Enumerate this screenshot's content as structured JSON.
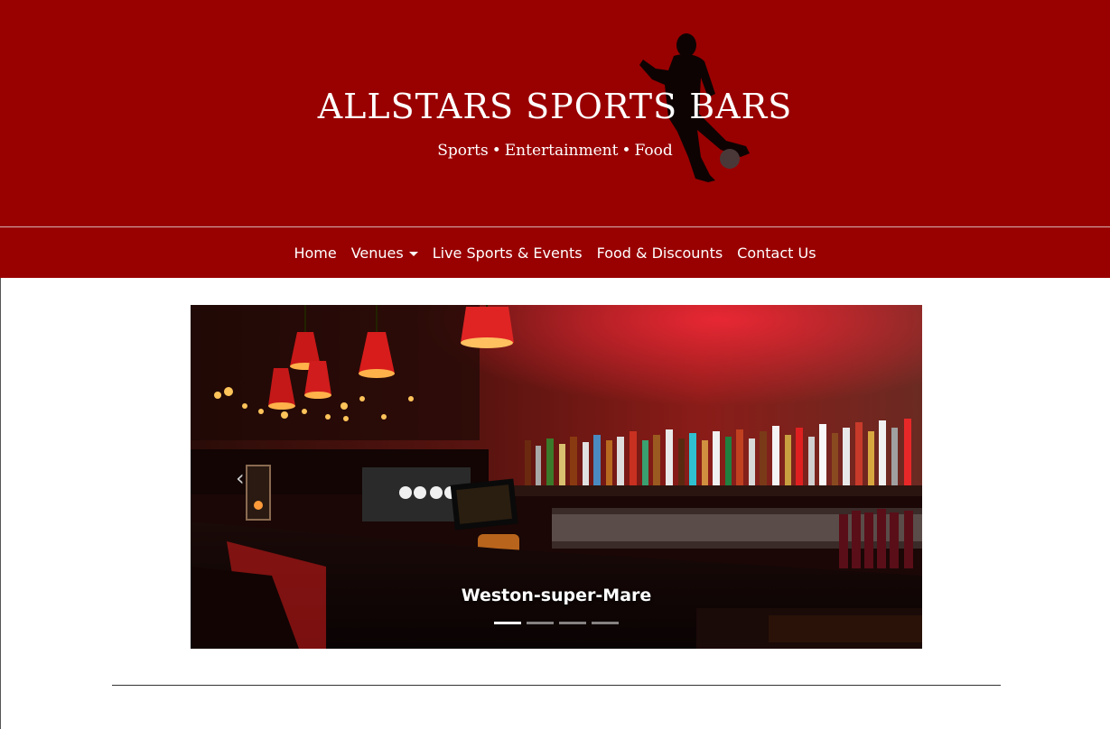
{
  "header": {
    "title": "ALLSTARS SPORTS BARS",
    "tagline_parts": [
      "Sports",
      "Entertainment",
      "Food"
    ],
    "tagline_separator": "•",
    "background_color": "#990000",
    "logo_icon": "footballer-silhouette-icon"
  },
  "nav": {
    "items": [
      {
        "label": "Home"
      },
      {
        "label": "Venues",
        "has_dropdown": true
      },
      {
        "label": "Live Sports & Events"
      },
      {
        "label": "Food & Discounts"
      },
      {
        "label": "Contact Us"
      }
    ]
  },
  "carousel": {
    "caption": "Weston-super-Mare",
    "prev_icon": "‹",
    "slide_count": 4,
    "active_index": 0
  }
}
